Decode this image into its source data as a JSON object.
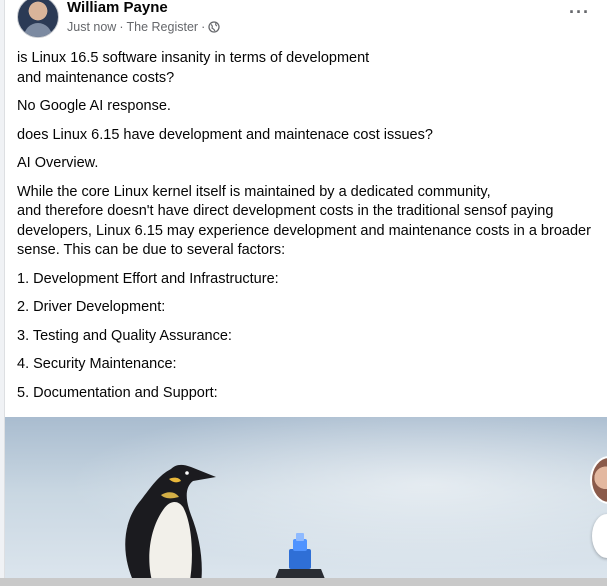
{
  "post": {
    "author": "William Payne",
    "timestamp": "Just now",
    "separator": "·",
    "source": "The Register",
    "separator2": "·",
    "privacy_icon": "globe-icon",
    "more_icon": "more-options-icon",
    "more_label": "···"
  },
  "body": {
    "p1_line1": "is Linux 16.5 software insanity in terms of development",
    "p1_line2": "and maintenance costs?",
    "p2": "No Google AI response.",
    "p3": "does Linux 6.15 have development and maintenace cost issues?",
    "p4": "AI Overview.",
    "p5_line1": "While the core Linux kernel itself is maintained by a dedicated community,",
    "p5_line2": "and therefore doesn't have direct development costs in the traditional sensof paying developers, Linux 6.15 may experience development and maintenance costs in a broader sense. This can be due to several factors:",
    "items": [
      "1. Development Effort and Infrastructure:",
      "2. Driver Development:",
      "3. Testing and Quality Assurance:",
      "4. Security Maintenance:",
      "5. Documentation and Support:"
    ]
  },
  "image": {
    "subject": "penguin-and-keycap-photo"
  },
  "colors": {
    "name": "#050505",
    "meta": "#65676b",
    "card": "#ffffff",
    "background": "#f0f2f5"
  }
}
